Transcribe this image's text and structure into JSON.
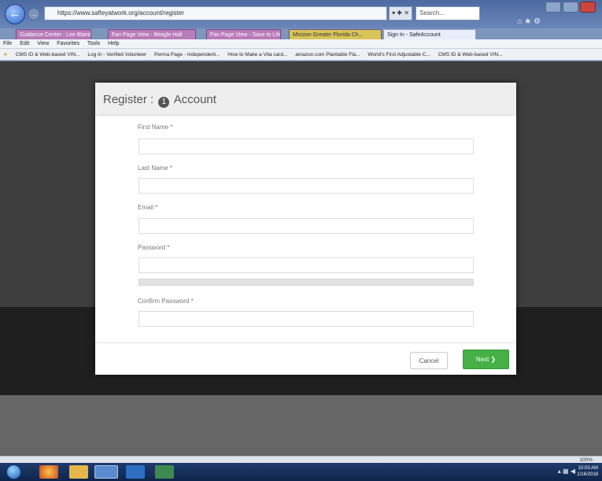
{
  "browser": {
    "address": "https://www.safteyatwork.org/account/register",
    "address_controls": "▾ ✚ ✕",
    "search_placeholder": "Search...",
    "tabs": [
      {
        "label": "Guidance Center - Lee Bland"
      },
      {
        "label": "Fan Page View - Beagle Hall"
      },
      {
        "label": "Fan Page View - Save to Life"
      },
      {
        "label": "Mission Greater Florida Ch..."
      },
      {
        "label": "Sign In - SafeAccount"
      }
    ],
    "menu": [
      "File",
      "Edit",
      "View",
      "Favorites",
      "Tools",
      "Help"
    ],
    "favorites": [
      "CMS ID & Web-based VIN...",
      "Log In - Verified Volunteer",
      "Perma Page - Independent...",
      "How to Make a Vita card...",
      "amazon.com Plantable Fla...",
      "World's First Adjustable C...",
      "CMS ID & Web-based VIN..."
    ]
  },
  "modal": {
    "title_prefix": "Register :",
    "title_icon": "1",
    "title_suffix": "Account",
    "fields": {
      "first_name": {
        "label": "First Name *",
        "value": ""
      },
      "last_name": {
        "label": "Last Name *",
        "value": ""
      },
      "email": {
        "label": "Email *",
        "value": ""
      },
      "password": {
        "label": "Password *",
        "value": ""
      },
      "confirm_password": {
        "label": "Confirm Password *",
        "value": ""
      }
    },
    "cancel_label": "Cancel",
    "next_label": "Next ❯"
  },
  "status": {
    "zoom": "100%"
  },
  "taskbar": {
    "clock_time": "10:03 AM",
    "clock_date": "1/16/2018"
  },
  "icons": {
    "back": "back-arrow-icon",
    "forward": "forward-arrow-icon",
    "account": "account-number-icon"
  }
}
